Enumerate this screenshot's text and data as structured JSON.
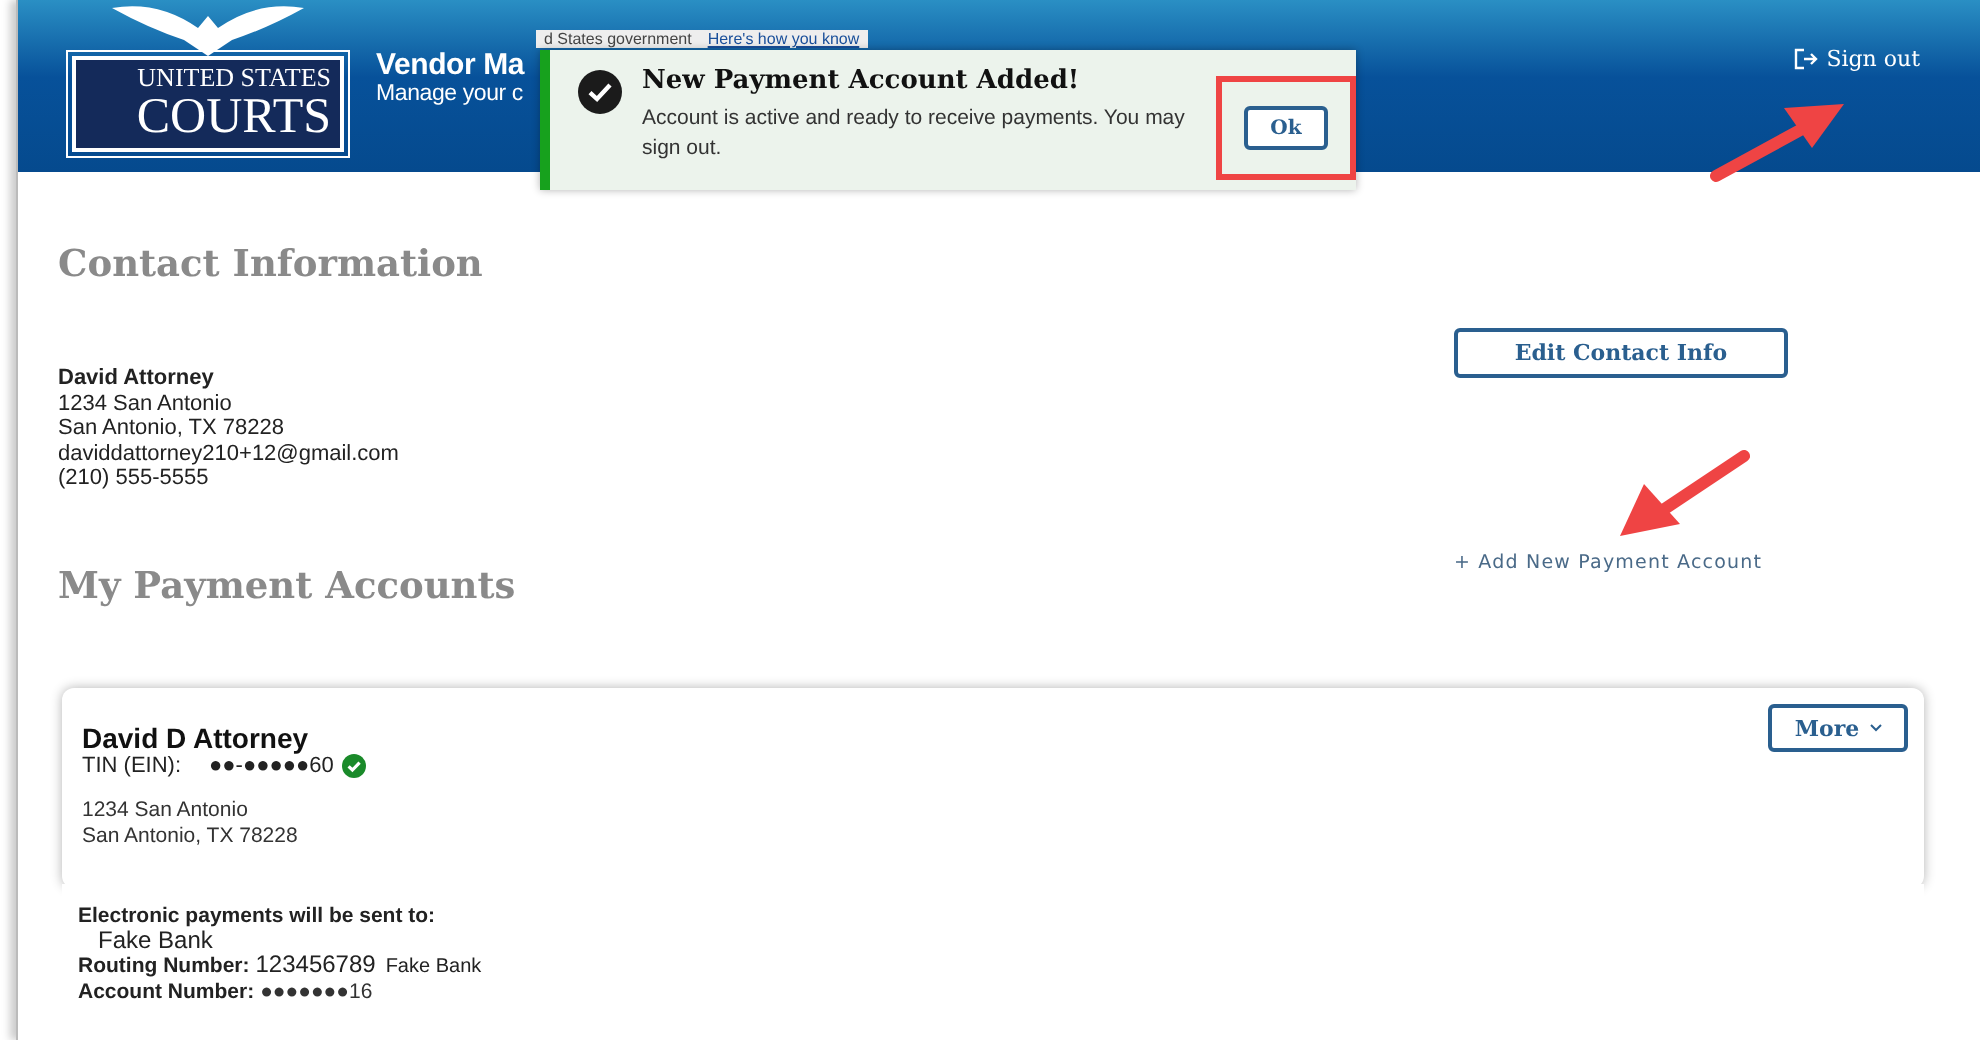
{
  "header": {
    "logo": {
      "line1": "UNITED STATES",
      "line2": "COURTS"
    },
    "title": "Vendor Ma",
    "subtitle": "Manage your c",
    "sign_out": "Sign out"
  },
  "gov_banner": {
    "text": "d States government",
    "link": "Here's how you know"
  },
  "toast": {
    "title": "New Payment Account Added!",
    "message": "Account is active and ready to receive payments. You may sign out.",
    "button": "Ok"
  },
  "contact": {
    "heading": "Contact Information",
    "name": "David Attorney",
    "lines": [
      "1234 San Antonio",
      "San Antonio, TX 78228",
      "daviddattorney210+12@gmail.com",
      "(210) 555-5555"
    ],
    "edit_button": "Edit Contact Info"
  },
  "payments": {
    "heading": "My Payment Accounts",
    "add_link": "+ Add New Payment Account",
    "account": {
      "name": "David D Attorney",
      "tin_label": "TIN (EIN):",
      "tin_value": "●●-●●●●●60",
      "verified": true,
      "address": [
        "1234 San Antonio",
        "San Antonio, TX 78228"
      ],
      "more_button": "More",
      "sent_to_label": "Electronic payments will be sent to:",
      "bank": "Fake Bank",
      "routing_label": "Routing Number:",
      "routing_value": "123456789",
      "routing_bank": "Fake Bank",
      "account_label": "Account Number:",
      "account_value": "●●●●●●●16"
    }
  }
}
